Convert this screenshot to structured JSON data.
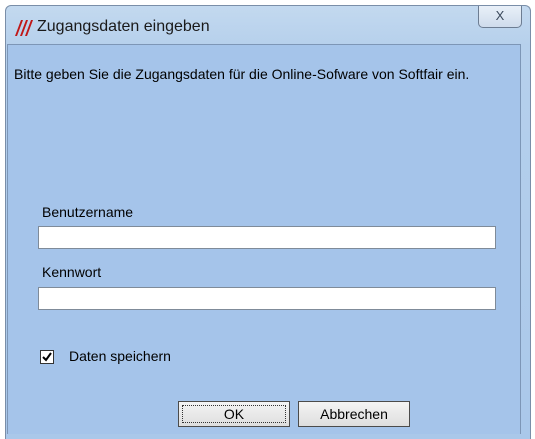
{
  "window": {
    "title": "Zugangsdaten eingeben",
    "close_glyph": "X",
    "app_icon": "softfair-logo-icon"
  },
  "dialog": {
    "intro_text": "Bitte geben Sie die Zugangsdaten für die Online-Sofware von Softfair ein.",
    "username_label": "Benutzername",
    "username_value": "",
    "password_label": "Kennwort",
    "password_value": "",
    "save_label": "Daten speichern",
    "save_checked": true,
    "ok_label": "OK",
    "cancel_label": "Abbrechen"
  },
  "colors": {
    "background": "#a5c4ea",
    "logo_red": "#c01818"
  }
}
